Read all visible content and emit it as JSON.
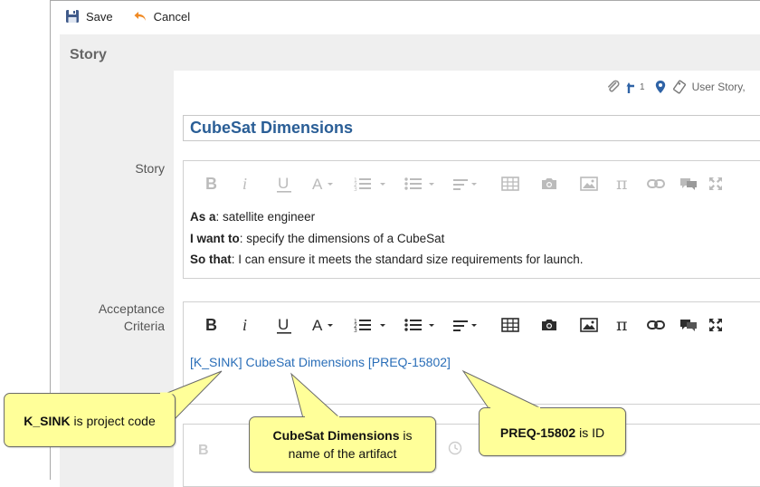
{
  "toolbar": {
    "save_label": "Save",
    "cancel_label": "Cancel"
  },
  "panel": {
    "title": "Story"
  },
  "meta": {
    "link_count": "1",
    "type_label": "User Story,"
  },
  "artifact": {
    "title": "CubeSat Dimensions"
  },
  "fields": {
    "story_label": "Story",
    "acceptance_label_line1": "Acceptance",
    "acceptance_label_line2": "Criteria"
  },
  "story": {
    "as_a_label": "As a",
    "as_a_text": ": satellite engineer",
    "i_want_label": "I want to",
    "i_want_text": ": specify the dimensions of a CubeSat",
    "so_that_label": "So that",
    "so_that_text": ": I can ensure it meets the standard size requirements for launch."
  },
  "acceptance": {
    "link_text": "[K_SINK] CubeSat Dimensions [PREQ-15802]"
  },
  "callouts": {
    "project_code_bold": "K_SINK",
    "project_code_text": " is project code",
    "name_bold": "CubeSat Dimensions",
    "name_text1": " is",
    "name_text2": "name of the artifact",
    "id_bold": "PREQ-15802",
    "id_text": " is ID"
  },
  "colors": {
    "accent": "#2a5e96",
    "link": "#2a6eb8",
    "callout_bg": "#ffff99",
    "panel_bg": "#efefef"
  }
}
